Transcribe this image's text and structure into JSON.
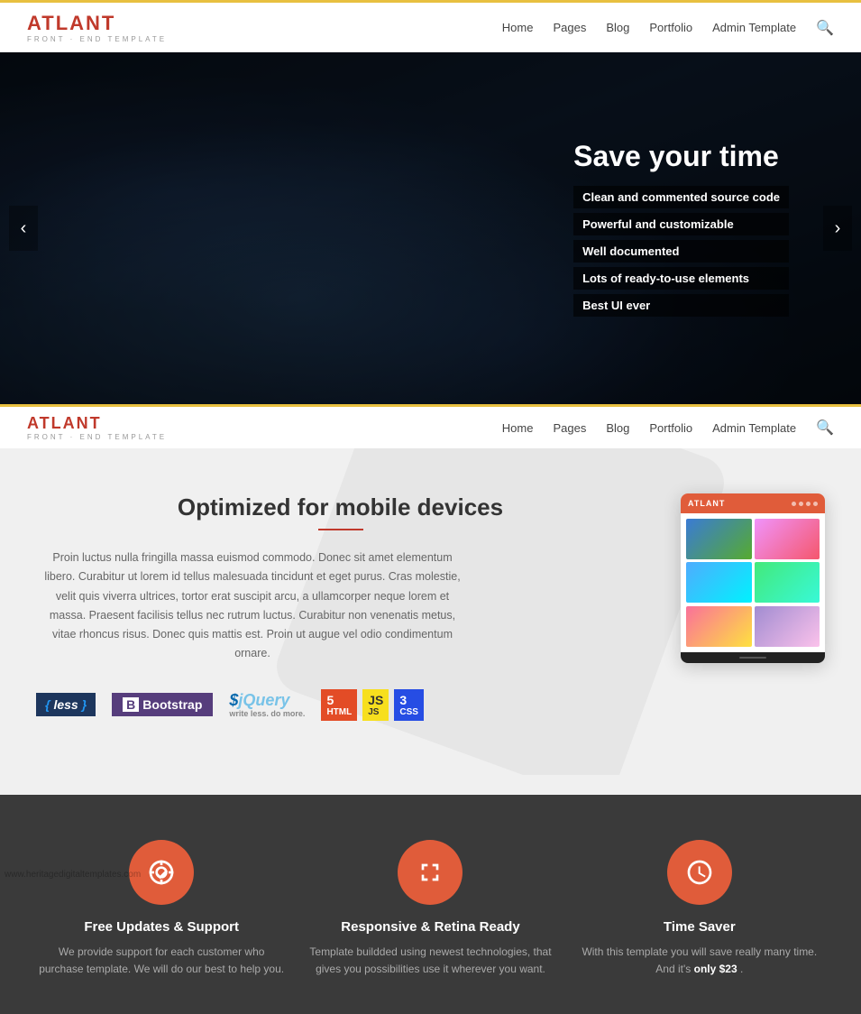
{
  "site": {
    "logo_letter": "A",
    "logo_name": "TLANT",
    "logo_sub": "FRONT · END TEMPLATE"
  },
  "nav": {
    "items": [
      "Home",
      "Pages",
      "Blog",
      "Portfolio",
      "Admin Template"
    ],
    "search_label": "Search"
  },
  "hero": {
    "title": "Save your time",
    "bullets": [
      "Clean and commented source code",
      "Powerful and customizable",
      "Well documented",
      "Lots of ready-to-use elements",
      "Best UI ever"
    ],
    "arrow_left": "‹",
    "arrow_right": "›"
  },
  "features": {
    "heading": "Optimized for mobile devices",
    "divider_color": "#c0392b",
    "description": "Proin luctus nulla fringilla massa euismod commodo. Donec sit amet elementum libero. Curabitur ut lorem id tellus malesuada tincidunt et eget purus. Cras molestie, velit quis viverra ultrices, tortor erat suscipit arcu, a ullamcorper neque lorem et massa. Praesent facilisis tellus nec rutrum luctus. Curabitur non venenatis metus, vitae rhoncus risus. Donec quis mattis est. Proin ut augue vel odio condimentum ornare.",
    "tech": {
      "less": "less",
      "bootstrap": "Bootstrap",
      "jquery": "jQuery",
      "html5": "HTML",
      "js": "JS",
      "css3": "CSS"
    }
  },
  "feature_cards": [
    {
      "icon": "lifesaver",
      "title": "Free Updates & Support",
      "desc_start": "We provide support for each customer who purchase template. We will do our best to help you."
    },
    {
      "icon": "arrows",
      "title": "Responsive & Retina Ready",
      "desc_start": "Template buildded using newest technologies, that gives you possibilities use it wherever you want."
    },
    {
      "icon": "clock",
      "title": "Time Saver",
      "desc_start": "With this template you will save really many time. And it's ",
      "desc_highlight": "only $23",
      "desc_end": "."
    }
  ],
  "watermark": "www.heritagedigitaltemplates.com"
}
